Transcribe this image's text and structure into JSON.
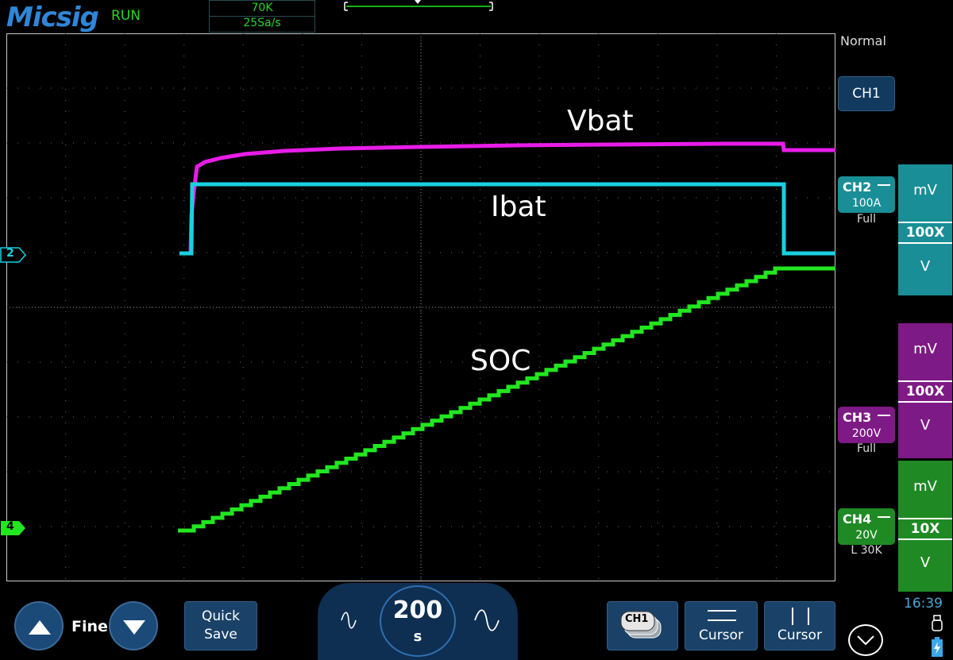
{
  "header": {
    "brand": "Micsig",
    "run_status": "RUN",
    "memory_depth": "70K",
    "sample_rate": "25Sa/s"
  },
  "trigger_mode": "Normal",
  "channels": {
    "ch1": {
      "label": "CH1"
    },
    "ch2": {
      "label": "CH2",
      "scale": "100A",
      "coupling": "Full",
      "unit_top": "mV",
      "probe": "100X",
      "unit_bottom": "V",
      "color": "#19d0e0"
    },
    "ch3": {
      "label": "CH3",
      "scale": "200V",
      "coupling": "Full",
      "unit_top": "mV",
      "probe": "100X",
      "unit_bottom": "V",
      "color": "#e81ce8"
    },
    "ch4": {
      "label": "CH4",
      "scale": "20V",
      "coupling": "L 30K",
      "unit_top": "mV",
      "probe": "10X",
      "unit_bottom": "V",
      "color": "#22e61f"
    }
  },
  "markers": {
    "ch2": "2",
    "ch4": "4"
  },
  "trace_labels": {
    "vbat": "Vbat",
    "ibat": "Ibat",
    "soc": "SOC"
  },
  "toolbar": {
    "fine_label": "Fine",
    "quick_save_line1": "Quick",
    "quick_save_line2": "Save",
    "timebase_value": "200",
    "timebase_unit": "s",
    "channel_menu": "CH1",
    "cursor_h_label": "Cursor",
    "cursor_v_label": "Cursor"
  },
  "clock": "16:39",
  "icons": {
    "up": "up-arrow-icon",
    "down": "down-arrow-icon",
    "wave_left": "sine-wave-icon",
    "wave_right": "sine-wave-icon",
    "usb": "usb-icon",
    "battery": "battery-charging-icon",
    "expand": "chevron-down-icon"
  }
}
